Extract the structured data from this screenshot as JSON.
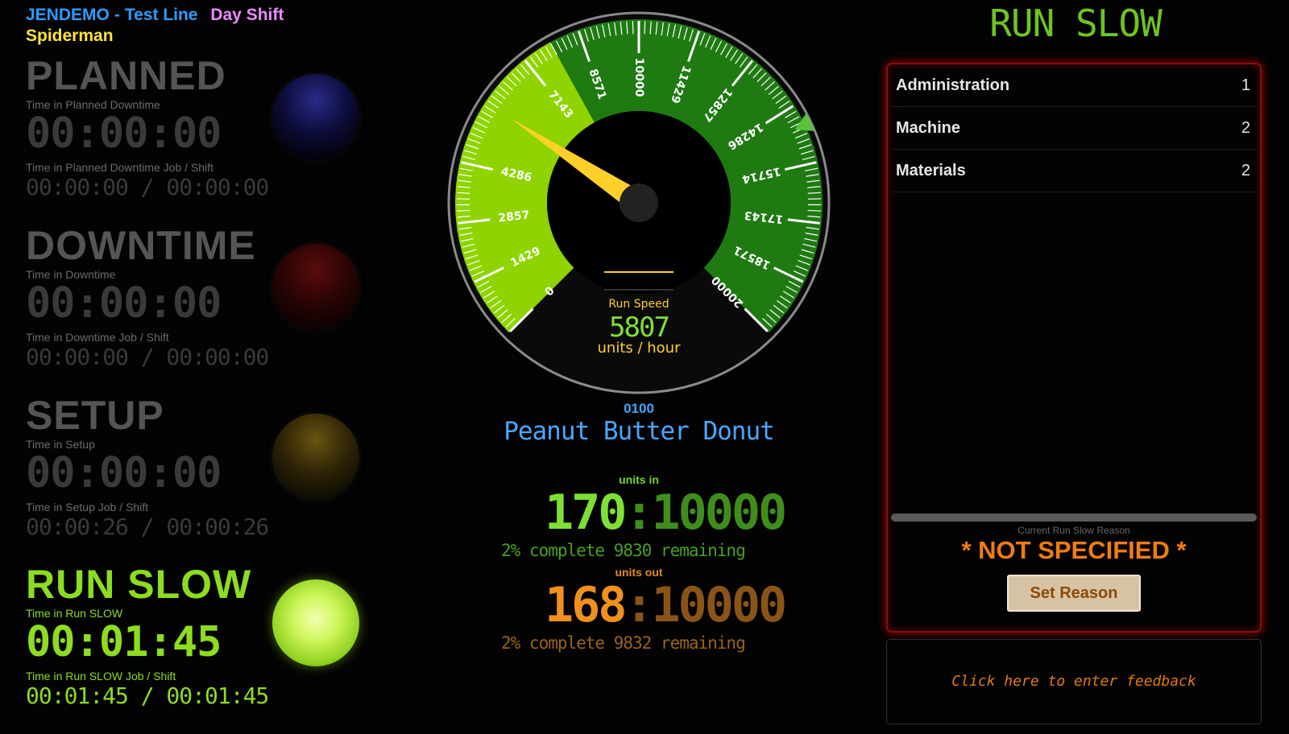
{
  "header": {
    "site": "JENDEMO",
    "separator": "-",
    "line": "Test Line",
    "shift": "Day Shift",
    "operator": "Spiderman"
  },
  "states": [
    {
      "title": "PLANNED",
      "label": "Time in Planned Downtime",
      "time": "00:00:00",
      "label2": "Time in Planned Downtime Job / Shift",
      "time2": "00:00:00 / 00:00:00",
      "lamp_color": "#1a1a6a"
    },
    {
      "title": "DOWNTIME",
      "label": "Time in Downtime",
      "time": "00:00:00",
      "label2": "Time in Downtime Job / Shift",
      "time2": "00:00:00 / 00:00:00",
      "lamp_color": "#4a0808"
    },
    {
      "title": "SETUP",
      "label": "Time in Setup",
      "time": "00:00:00",
      "label2": "Time in Setup Job / Shift",
      "time2": "00:00:26 / 00:00:26",
      "lamp_color": "#4a3808"
    },
    {
      "title": "RUN SLOW",
      "label": "Time in Run SLOW",
      "time": "00:01:45",
      "label2": "Time in Run SLOW Job / Shift",
      "time2": "00:01:45 / 00:01:45",
      "lamp_color": "#b6ee3c"
    }
  ],
  "gauge": {
    "label": "Run Speed",
    "value": "5807",
    "unit": "units / hour",
    "min": 0,
    "max": 20000,
    "needle_value": 5807,
    "marker_value": 14800,
    "ticks": [
      "0",
      "1429",
      "2857",
      "4286",
      "7143",
      "8571",
      "10000",
      "11429",
      "12857",
      "14286",
      "15714",
      "17143",
      "18571",
      "20000"
    ],
    "colors": {
      "light": "#8fd400",
      "dark": "#1f7a12",
      "needle": "#ffd02a"
    }
  },
  "product": {
    "code": "0100",
    "name": "Peanut Butter Donut"
  },
  "units_in": {
    "label": "units in",
    "count": "170",
    "sep": ":",
    "target": "10000",
    "summary": "2% complete 9830 remaining"
  },
  "units_out": {
    "label": "units out",
    "count": "168",
    "sep": ":",
    "target": "10000",
    "summary": "2% complete 9832 remaining"
  },
  "right": {
    "state_title": "RUN SLOW",
    "reasons": [
      {
        "name": "Administration",
        "count": "1"
      },
      {
        "name": "Machine",
        "count": "2"
      },
      {
        "name": "Materials",
        "count": "2"
      }
    ],
    "current_reason_label": "Current Run Slow Reason",
    "current_reason": "* NOT SPECIFIED *",
    "set_reason_label": "Set Reason",
    "feedback_text": "Click here to enter feedback"
  }
}
